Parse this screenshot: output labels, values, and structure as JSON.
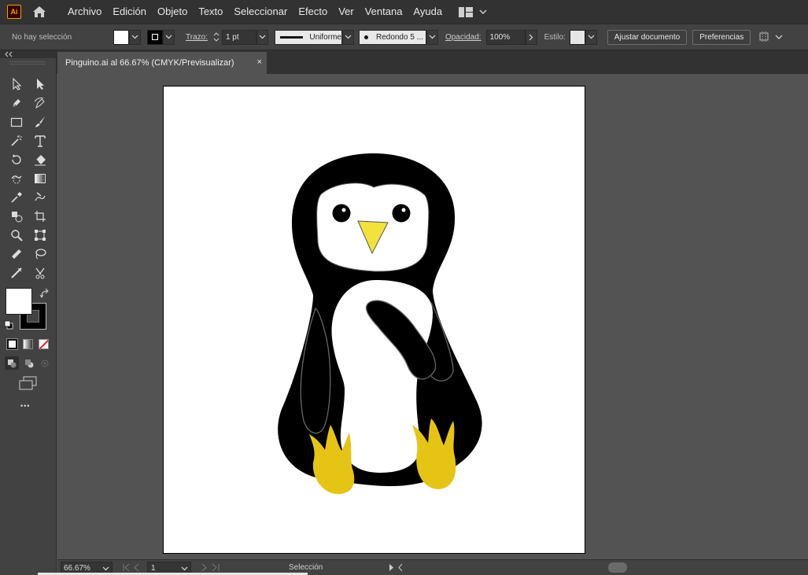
{
  "app": {
    "logo": "Ai",
    "home_icon": "home-icon"
  },
  "menu": [
    "Archivo",
    "Edición",
    "Objeto",
    "Texto",
    "Seleccionar",
    "Efecto",
    "Ver",
    "Ventana",
    "Ayuda"
  ],
  "control": {
    "selection_status": "No hay selección",
    "stroke_label": "Trazo:",
    "stroke_weight": "1 pt",
    "stroke_profile": "Uniforme",
    "brush": "Redondo 5 ...",
    "opacity_label": "Opacidad:",
    "opacity_value": "100%",
    "style_label": "Estilo:",
    "ajustar_documento": "Ajustar documento",
    "preferencias": "Preferencias"
  },
  "document": {
    "tab_title": "Pinguino.ai al 66.67% (CMYK/Previsualizar)",
    "close_glyph": "×"
  },
  "toolbar": {
    "more_glyph": "•••"
  },
  "status": {
    "zoom": "66.67%",
    "artboard_number": "1",
    "current_tool": "Selección"
  },
  "colors": {
    "ui_dark": "#323232",
    "ui_panel": "#424242",
    "canvas": "#535353",
    "penguin_body": "#000000",
    "penguin_belly": "#ffffff",
    "beak": "#f2e33c",
    "feet": "#e6c415",
    "outline": "#555555"
  }
}
